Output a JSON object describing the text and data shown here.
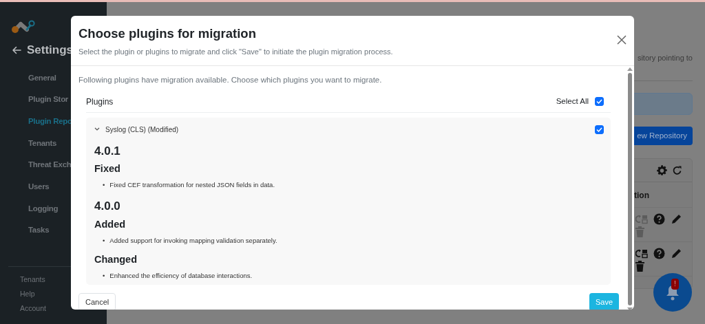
{
  "sidebar": {
    "title": "Settings",
    "items": [
      {
        "label": "General",
        "selected": false
      },
      {
        "label": "Plugin Stor",
        "selected": false
      },
      {
        "label": "Plugin Repo",
        "selected": true
      },
      {
        "label": "Tenants",
        "selected": false
      },
      {
        "label": "Threat Exch",
        "selected": false
      },
      {
        "label": "Users",
        "selected": false
      },
      {
        "label": "Logging",
        "selected": false
      },
      {
        "label": "Tasks",
        "selected": false
      }
    ],
    "footer_items": [
      "Tenants",
      "Help",
      "Account"
    ]
  },
  "page": {
    "description": "sitory pointing to",
    "new_button": "ew Repository",
    "table": {
      "column_header": "tion",
      "rows": [
        {
          "disabled": true
        },
        {
          "disabled": false
        }
      ]
    }
  },
  "notifications": {
    "badge": "!"
  },
  "modal": {
    "title": "Choose plugins for migration",
    "subtitle": "Select the plugin or plugins to migrate and click \"Save\" to initiate the plugin migration process.",
    "intro": "Following plugins have migration available. Choose which plugins you want to migrate.",
    "plugins_label": "Plugins",
    "select_all": {
      "label": "Select All",
      "checked": true
    },
    "plugins": [
      {
        "name": "Syslog (CLS) (Modified)",
        "expanded": true,
        "checked": true,
        "changelog": [
          {
            "version": "4.0.1",
            "sections": [
              {
                "heading": "Fixed",
                "items": [
                  {
                    "marker": "•",
                    "text": "Fixed CEF transformation for nested JSON fields in data."
                  }
                ]
              }
            ]
          },
          {
            "version": "4.0.0",
            "sections": [
              {
                "heading": "Added",
                "items": [
                  {
                    "marker": "•",
                    "text": "Added support for invoking mapping validation separately."
                  }
                ]
              },
              {
                "heading": "Changed",
                "items": [
                  {
                    "marker": "•",
                    "text": "Enhanced the efficiency of database interactions."
                  }
                ]
              }
            ]
          }
        ]
      }
    ],
    "buttons": [
      {
        "label": "Cancel",
        "kind": "secondary"
      },
      {
        "label": "Save",
        "kind": "primary"
      }
    ]
  }
}
